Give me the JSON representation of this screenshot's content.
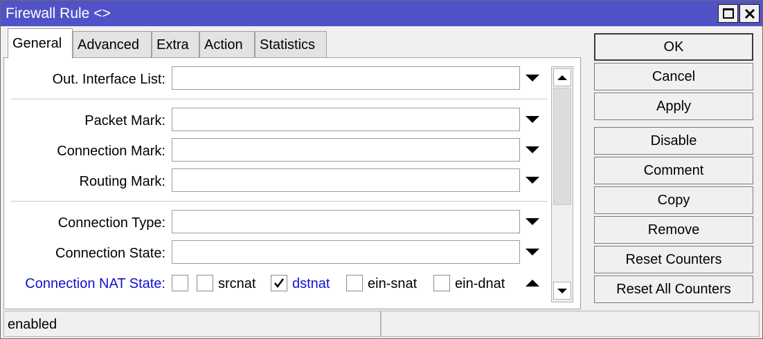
{
  "window": {
    "title": "Firewall Rule <>"
  },
  "tabs": [
    {
      "label": "General",
      "active": true
    },
    {
      "label": "Advanced",
      "active": false
    },
    {
      "label": "Extra",
      "active": false
    },
    {
      "label": "Action",
      "active": false
    },
    {
      "label": "Statistics",
      "active": false
    }
  ],
  "form": {
    "out_interface_list": {
      "label": "Out. Interface List:",
      "value": ""
    },
    "packet_mark": {
      "label": "Packet Mark:",
      "value": ""
    },
    "connection_mark": {
      "label": "Connection Mark:",
      "value": ""
    },
    "routing_mark": {
      "label": "Routing Mark:",
      "value": ""
    },
    "connection_type": {
      "label": "Connection Type:",
      "value": ""
    },
    "connection_state": {
      "label": "Connection State:",
      "value": ""
    },
    "connection_nat_state": {
      "label": "Connection NAT State:",
      "negate_checked": false,
      "options": [
        {
          "label": "srcnat",
          "checked": false
        },
        {
          "label": "dstnat",
          "checked": true
        },
        {
          "label": "ein-snat",
          "checked": false
        },
        {
          "label": "ein-dnat",
          "checked": false
        }
      ]
    }
  },
  "buttons": {
    "ok": "OK",
    "cancel": "Cancel",
    "apply": "Apply",
    "disable": "Disable",
    "comment": "Comment",
    "copy": "Copy",
    "remove": "Remove",
    "reset_counters": "Reset Counters",
    "reset_all_counters": "Reset All Counters"
  },
  "status": {
    "left": "enabled",
    "right": ""
  },
  "colors": {
    "titlebar": "#5252c8",
    "highlight_label": "#1010d0"
  },
  "icons": [
    "maximize-icon",
    "close-icon",
    "dropdown-arrow-icon",
    "scroll-up-icon",
    "scroll-down-icon",
    "collapse-arrow-icon",
    "checkmark-icon"
  ]
}
